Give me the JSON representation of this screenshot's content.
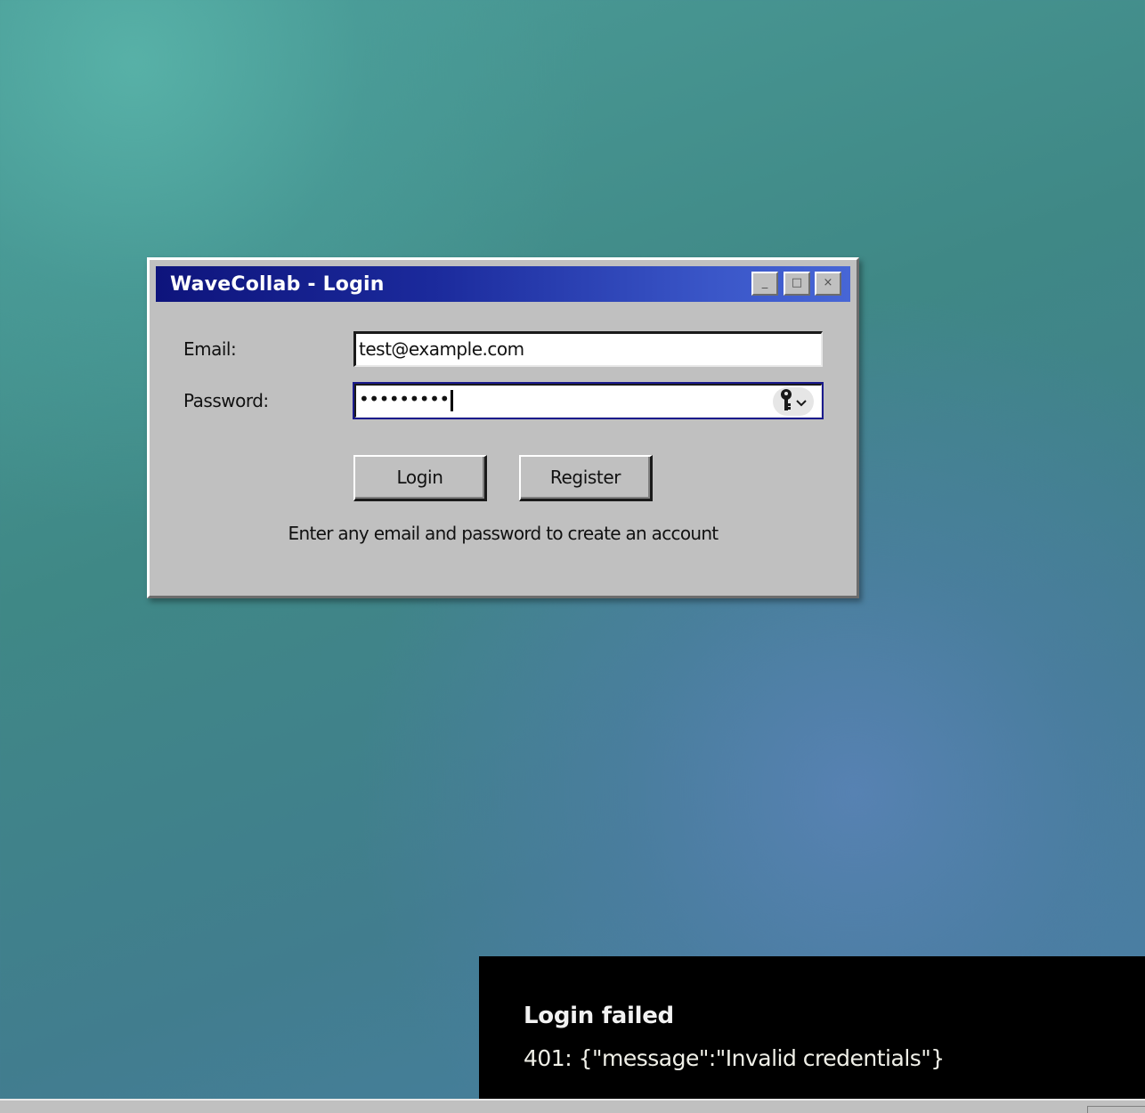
{
  "window": {
    "title": "WaveCollab - Login",
    "controls": {
      "minimize": "_",
      "maximize": "□",
      "close": "×"
    }
  },
  "form": {
    "email_label": "Email:",
    "email_value": "test@example.com",
    "password_label": "Password:",
    "password_value": "•••••••••",
    "password_manager_icon": "key-icon"
  },
  "buttons": {
    "login": "Login",
    "register": "Register"
  },
  "hint": "Enter any email and password to create an account",
  "toast": {
    "title": "Login failed",
    "message": "401: {\"message\":\"Invalid credentials\"}"
  },
  "colors": {
    "titlebar_start": "#0e147c",
    "titlebar_end": "#4766d6",
    "window_face": "#c0c0c0",
    "toast_bg": "#000000"
  }
}
